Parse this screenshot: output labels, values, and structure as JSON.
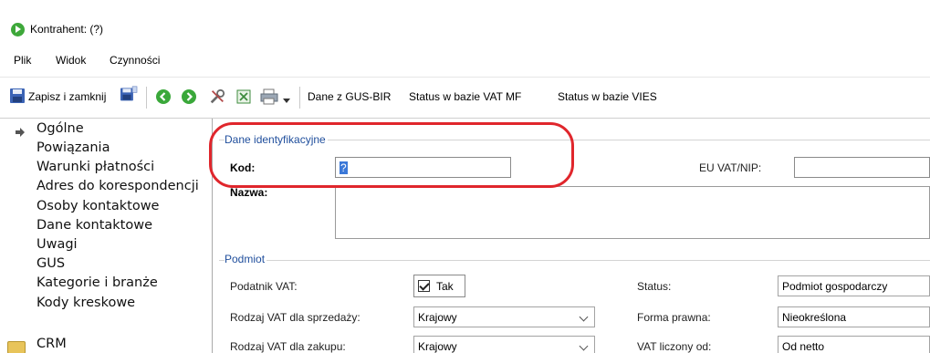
{
  "window": {
    "title": "Kontrahent: (?)"
  },
  "menu": [
    "Plik",
    "Widok",
    "Czynności"
  ],
  "toolbar": {
    "save_close": "Zapisz i zamknij",
    "gus": "Dane z GUS-BIR",
    "vat_mf": "Status w bazie VAT MF",
    "vies": "Status w bazie VIES"
  },
  "sidebar": {
    "items": [
      "Ogólne",
      "Powiązania",
      "Warunki płatności",
      "Adres do korespondencji",
      "Osoby kontaktowe",
      "Dane kontaktowe",
      "Uwagi",
      "GUS",
      "Kategorie i branże",
      "Kody kreskowe",
      "CRM"
    ]
  },
  "identification": {
    "group_label": "Dane identyfikacyjne",
    "kod_label": "Kod:",
    "kod_value": "?",
    "nazwa_label": "Nazwa:",
    "eu_vat_label": "EU VAT/NIP:",
    "eu_vat_value": ""
  },
  "podmiot": {
    "group_label": "Podmiot",
    "podatnik_label": "Podatnik VAT:",
    "podatnik_value": "Tak",
    "rodzaj_sprz_label": "Rodzaj VAT dla sprzedaży:",
    "rodzaj_sprz_value": "Krajowy",
    "rodzaj_zak_label": "Rodzaj VAT dla zakupu:",
    "rodzaj_zak_value": "Krajowy",
    "status_label": "Status:",
    "status_value": "Podmiot gospodarczy",
    "forma_label": "Forma prawna:",
    "forma_value": "Nieokreślona",
    "vat_od_label": "VAT liczony od:",
    "vat_od_value": "Od netto"
  },
  "colors": {
    "group_label": "#1f4e9c",
    "highlight": "#e0262c",
    "app_icon": "#3ea83a"
  }
}
